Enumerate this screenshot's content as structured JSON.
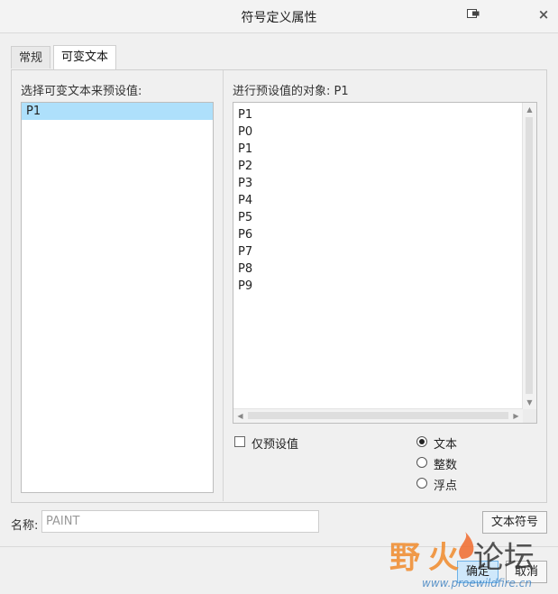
{
  "window": {
    "title": "符号定义属性"
  },
  "tabs": [
    {
      "label": "常规",
      "active": false
    },
    {
      "label": "可变文本",
      "active": true
    }
  ],
  "left": {
    "label": "选择可变文本来预设值:",
    "items": [
      "P1"
    ],
    "selected_index": 0
  },
  "right": {
    "label": "进行预设值的对象: P1",
    "items": [
      "P1",
      "P0",
      "P1",
      "P2",
      "P3",
      "P4",
      "P5",
      "P6",
      "P7",
      "P8",
      "P9"
    ]
  },
  "options": {
    "preset_only_label": "仅预设值",
    "preset_only_checked": false,
    "type_options": [
      "文本",
      "整数",
      "浮点"
    ],
    "type_selected": "文本"
  },
  "name": {
    "label": "名称:",
    "value": "PAINT"
  },
  "buttons": {
    "text_symbol": "文本符号",
    "ok": "确定",
    "cancel": "取消"
  },
  "watermark": {
    "text_main": "野火论坛",
    "text_url": "www.proewildfire.cn"
  },
  "colors": {
    "selection": "#aee0fb",
    "primary_button": "#cfe8fb"
  }
}
